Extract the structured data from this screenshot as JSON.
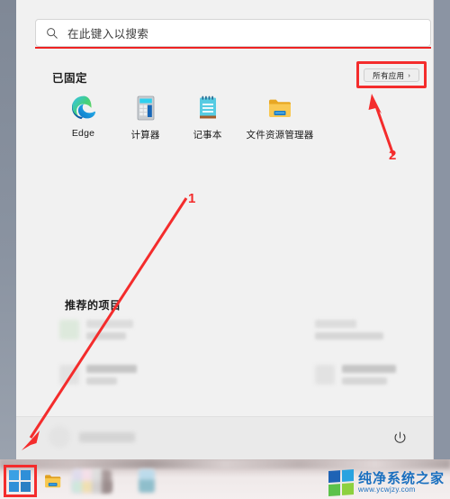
{
  "window": {
    "title": "Windows 11 Start Menu",
    "accent_red": "#f42c2c",
    "panel_bg": "#f1f1f1"
  },
  "search": {
    "placeholder": "在此键入以搜索",
    "value": "",
    "icon": "search-icon",
    "underline_color": "#ee2222"
  },
  "pinned": {
    "section_title": "已固定",
    "all_apps_label": "所有应用",
    "all_apps_chevron": "›",
    "apps": [
      {
        "label": "Edge",
        "icon": "edge-icon"
      },
      {
        "label": "计算器",
        "icon": "calculator-icon"
      },
      {
        "label": "记事本",
        "icon": "notepad-icon"
      },
      {
        "label": "文件资源管理器",
        "icon": "folder-icon"
      }
    ]
  },
  "recommended": {
    "section_title": "推荐的项目",
    "items": [
      {
        "label": "",
        "sublabel": "",
        "redacted": true
      },
      {
        "label": "",
        "sublabel": "",
        "redacted": true
      },
      {
        "label": "",
        "sublabel": "",
        "redacted": true
      },
      {
        "label": "",
        "sublabel": "",
        "redacted": true
      }
    ]
  },
  "start_bottom": {
    "user_name": "",
    "user_redacted": true,
    "power_icon": "power-icon"
  },
  "taskbar": {
    "start_button": {
      "name": "start-button",
      "icon": "windows-logo-icon",
      "highlighted": true
    },
    "items": [
      {
        "name": "file-explorer",
        "icon": "folder-icon"
      },
      {
        "name": "photos",
        "icon": "photos-icon"
      },
      {
        "name": "pinned-app",
        "icon": "app-icon"
      }
    ]
  },
  "watermark": {
    "title": "纯净系统之家",
    "url": "www.ycwjzy.com",
    "logo": "windows-tiles-icon"
  },
  "annotations": {
    "callouts": [
      {
        "number": "1",
        "target": "start-button",
        "description": "红色箭头指向任务栏开始按钮"
      },
      {
        "number": "2",
        "target": "all-apps-button",
        "description": "红色箭头指向所有应用按钮"
      }
    ],
    "highlights": [
      {
        "target": "all-apps-button",
        "color": "#f42c2c"
      },
      {
        "target": "start-button",
        "color": "#f42c2c"
      }
    ]
  }
}
